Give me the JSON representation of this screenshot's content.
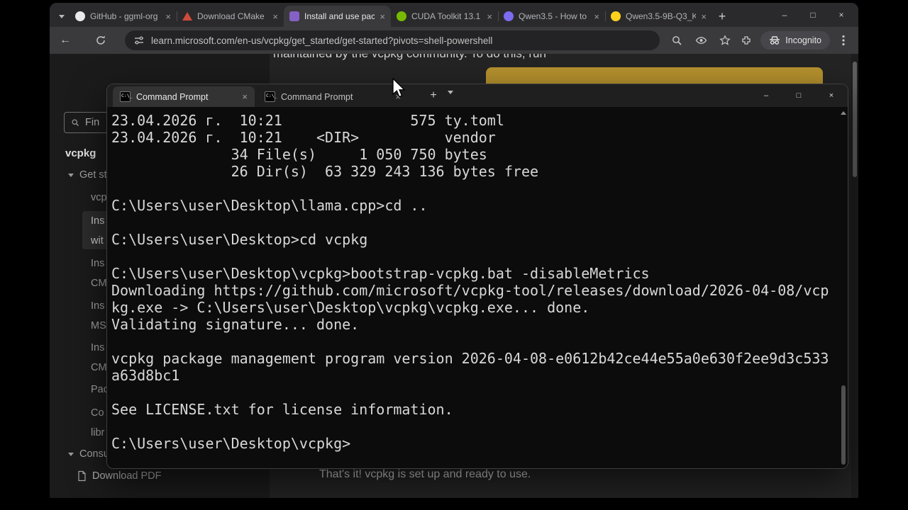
{
  "browser": {
    "window_controls": {
      "minimize": "–",
      "maximize": "□",
      "close": "×"
    },
    "tabs": [
      {
        "title": "GitHub - ggml-org",
        "favicon": "github",
        "color": "#e8eaed"
      },
      {
        "title": "Download CMake",
        "favicon": "cmake",
        "color": "#d04a3a"
      },
      {
        "title": "Install and use pac",
        "favicon": "ms-learn",
        "color": "#8661c5",
        "active": true
      },
      {
        "title": "CUDA Toolkit 13.1",
        "favicon": "cuda",
        "color": "#76b900"
      },
      {
        "title": "Qwen3.5 - How to",
        "favicon": "qwen",
        "color": "#7b6cf0"
      },
      {
        "title": "Qwen3.5-9B-Q3_K",
        "favicon": "huggingface",
        "color": "#ffd21e"
      }
    ],
    "toolbar": {
      "url": "learn.microsoft.com/en-us/vcpkg/get_started/get-started?pivots=shell-powershell",
      "incognito_label": "Incognito"
    }
  },
  "icons": {
    "close_glyph": "×",
    "plus_glyph": "+"
  },
  "docs_page": {
    "clipped_top_text": "maintained by the vcpkg community. To do this, run",
    "callout_color": "#b6922e",
    "completion_text": "That's it! vcpkg is set up and ready to use.",
    "sidebar": {
      "search_text": "Fin",
      "product_title": "vcpkg",
      "items": [
        {
          "lines": [
            "Get st"
          ]
        },
        {
          "lines": [
            "vcp"
          ]
        },
        {
          "lines": [
            "Ins",
            "wit"
          ],
          "selected": true
        },
        {
          "lines": [
            "Ins",
            "CM"
          ]
        },
        {
          "lines": [
            "Ins",
            "MS"
          ]
        },
        {
          "lines": [
            "Ins",
            "CM"
          ]
        },
        {
          "lines": [
            "Pac"
          ]
        },
        {
          "lines": [
            "Co",
            "libr"
          ]
        },
        {
          "lines": [
            "Consu"
          ]
        }
      ],
      "download_pdf_label": "Download PDF"
    }
  },
  "terminal": {
    "tabs": [
      {
        "title": "Command Prompt"
      },
      {
        "title": "Command Prompt"
      }
    ],
    "window_controls": {
      "minimize": "–",
      "maximize": "□",
      "close": "×"
    },
    "lines": [
      "23.04.2026 г.  10:21               575 ty.toml",
      "23.04.2026 г.  10:21    <DIR>          vendor",
      "              34 File(s)     1 050 750 bytes",
      "              26 Dir(s)  63 329 243 136 bytes free",
      "",
      "C:\\Users\\user\\Desktop\\llama.cpp>cd ..",
      "",
      "C:\\Users\\user\\Desktop>cd vcpkg",
      "",
      "C:\\Users\\user\\Desktop\\vcpkg>bootstrap-vcpkg.bat -disableMetrics",
      "Downloading https://github.com/microsoft/vcpkg-tool/releases/download/2026-04-08/vcp",
      "kg.exe -> C:\\Users\\user\\Desktop\\vcpkg\\vcpkg.exe... done.",
      "Validating signature... done.",
      "",
      "vcpkg package management program version 2026-04-08-e0612b42ce44e55a0e630f2ee9d3c533",
      "a63d8bc1",
      "",
      "See LICENSE.txt for license information.",
      "",
      "C:\\Users\\user\\Desktop\\vcpkg>"
    ]
  }
}
